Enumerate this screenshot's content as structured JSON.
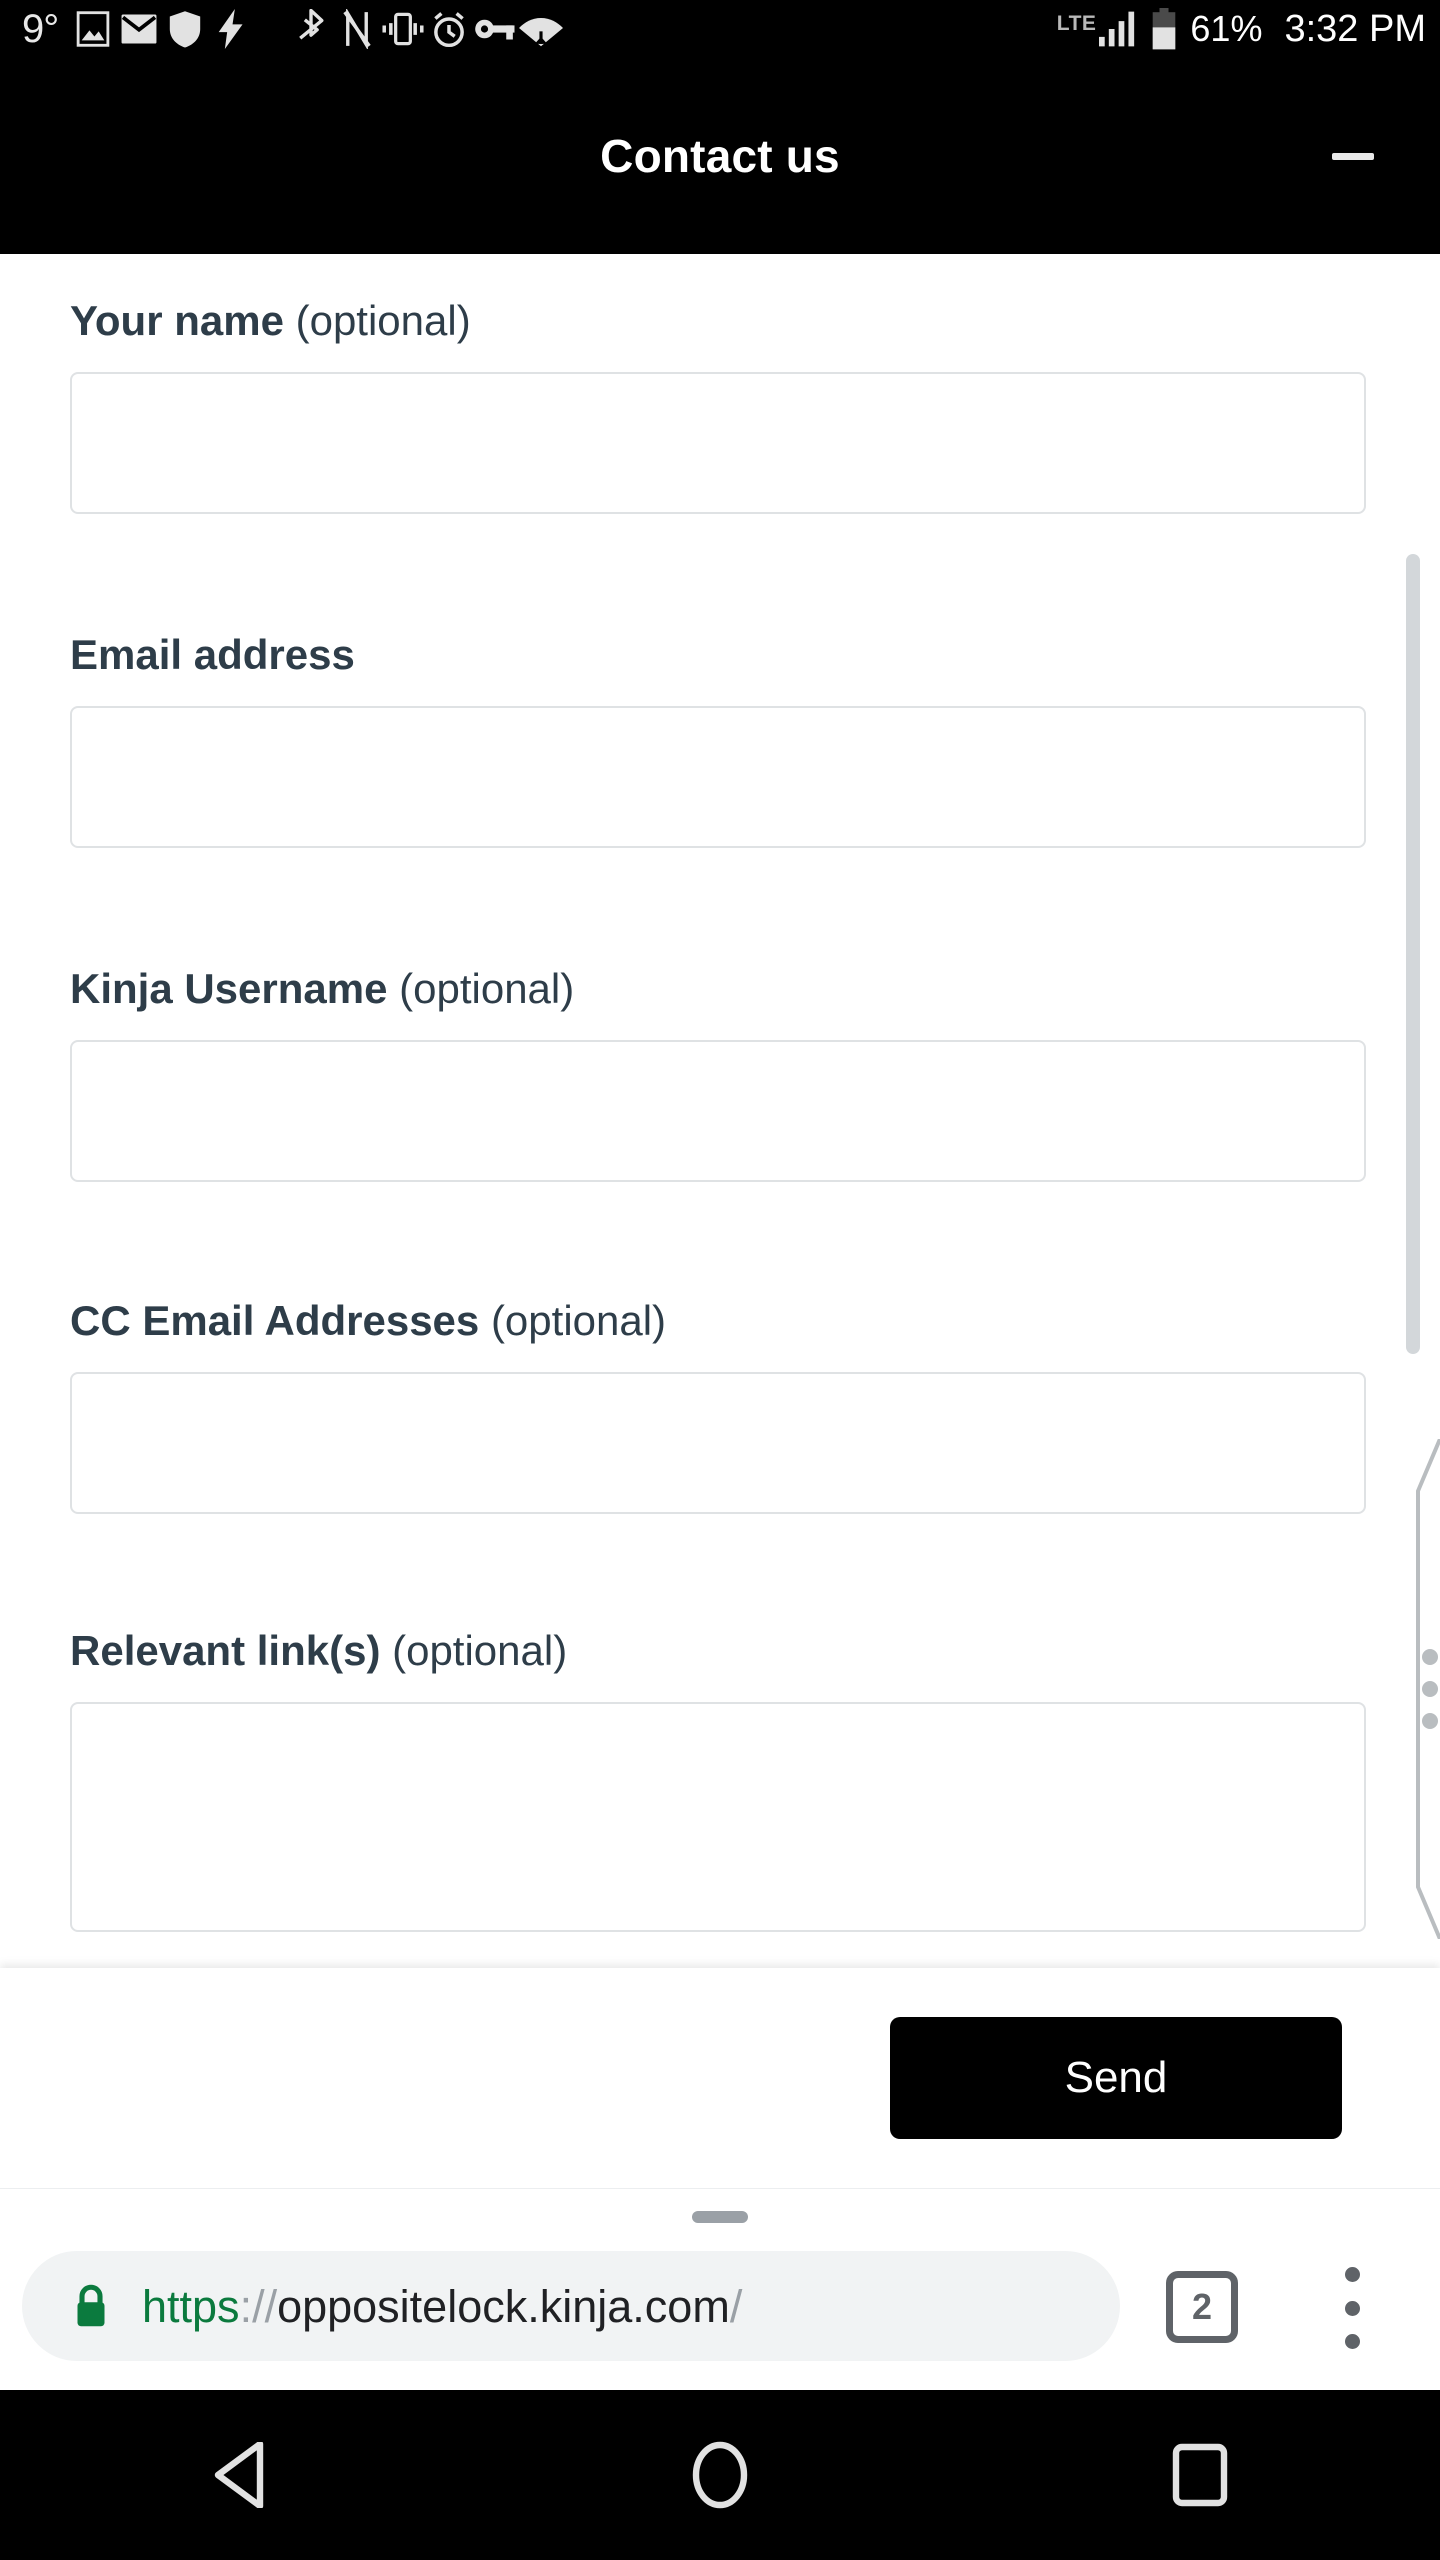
{
  "status_bar": {
    "temperature": "9°",
    "network_type": "LTE",
    "battery_percent": "61%",
    "clock": "3:32 PM",
    "icons": [
      "photo-icon",
      "email-icon",
      "shield-icon",
      "bolt-icon",
      "bluetooth-icon",
      "nfc-icon",
      "vibrate-icon",
      "alarm-icon",
      "vpn-key-icon",
      "wifi-icon",
      "signal-bars-icon",
      "battery-icon"
    ]
  },
  "modal": {
    "title": "Contact us",
    "minimize_label": "Minimize"
  },
  "form": {
    "fields": [
      {
        "label_strong": "Your name",
        "label_optional": " (optional)",
        "value": "",
        "type": "text"
      },
      {
        "label_strong": "Email address",
        "label_optional": "",
        "value": "",
        "type": "email"
      },
      {
        "label_strong": "Kinja Username",
        "label_optional": " (optional)",
        "value": "",
        "type": "text"
      },
      {
        "label_strong": "CC Email Addresses",
        "label_optional": " (optional)",
        "value": "",
        "type": "text"
      },
      {
        "label_strong": "Relevant link(s)",
        "label_optional": " (optional)",
        "value": "",
        "type": "textarea"
      }
    ],
    "submit_label": "Send"
  },
  "browser": {
    "url_scheme": "https",
    "url_separator": "://",
    "url_host": "oppositelock.kinja.com",
    "url_path": "/",
    "lock_icon": "secure-lock-icon",
    "tab_count": "2",
    "menu_icon": "overflow-menu-icon",
    "colors": {
      "secure_green": "#0b7a3e",
      "omnibox_bg": "#f1f3f4",
      "chrome_gray": "#5f6368"
    }
  },
  "android_nav": {
    "back_label": "Back",
    "home_label": "Home",
    "recents_label": "Recent apps"
  },
  "edge_handle": {
    "name": "side-drag-handle",
    "dots": 3
  }
}
